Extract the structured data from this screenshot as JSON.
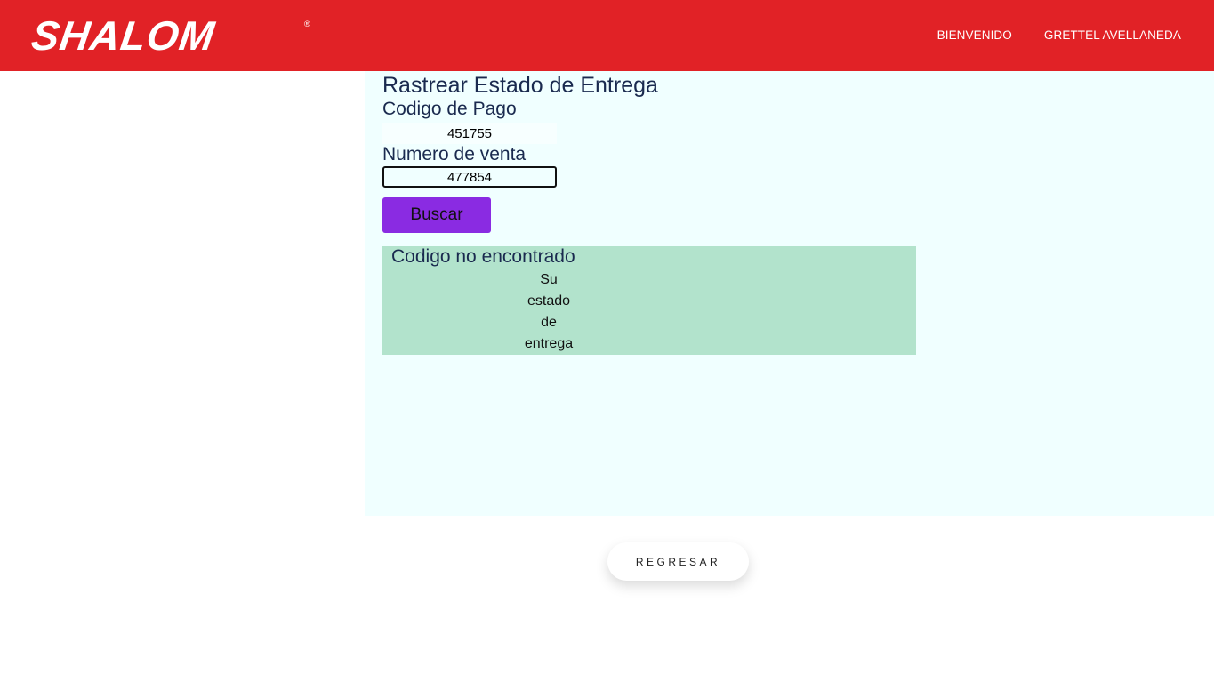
{
  "header": {
    "logo_text": "SHALOM",
    "logo_mark": "®",
    "nav": [
      {
        "label": "BIENVENIDO"
      },
      {
        "label": "GRETTEL AVELLANEDA"
      }
    ]
  },
  "form": {
    "title": "Rastrear Estado de Entrega",
    "codigo_label": "Codigo de Pago",
    "codigo_value": "451755",
    "venta_label": "Numero de venta",
    "venta_value": "477854",
    "search_button": "Buscar"
  },
  "result": {
    "title": "Codigo no encontrado",
    "body": "Su estado de entrega"
  },
  "footer": {
    "back_button": "REGRESAR"
  },
  "colors": {
    "header_bg": "#e12226",
    "panel_bg": "#f0ffff",
    "button_bg": "#8a2be2",
    "result_bg": "#b2e3cc",
    "heading_text": "#1a2a4f"
  }
}
